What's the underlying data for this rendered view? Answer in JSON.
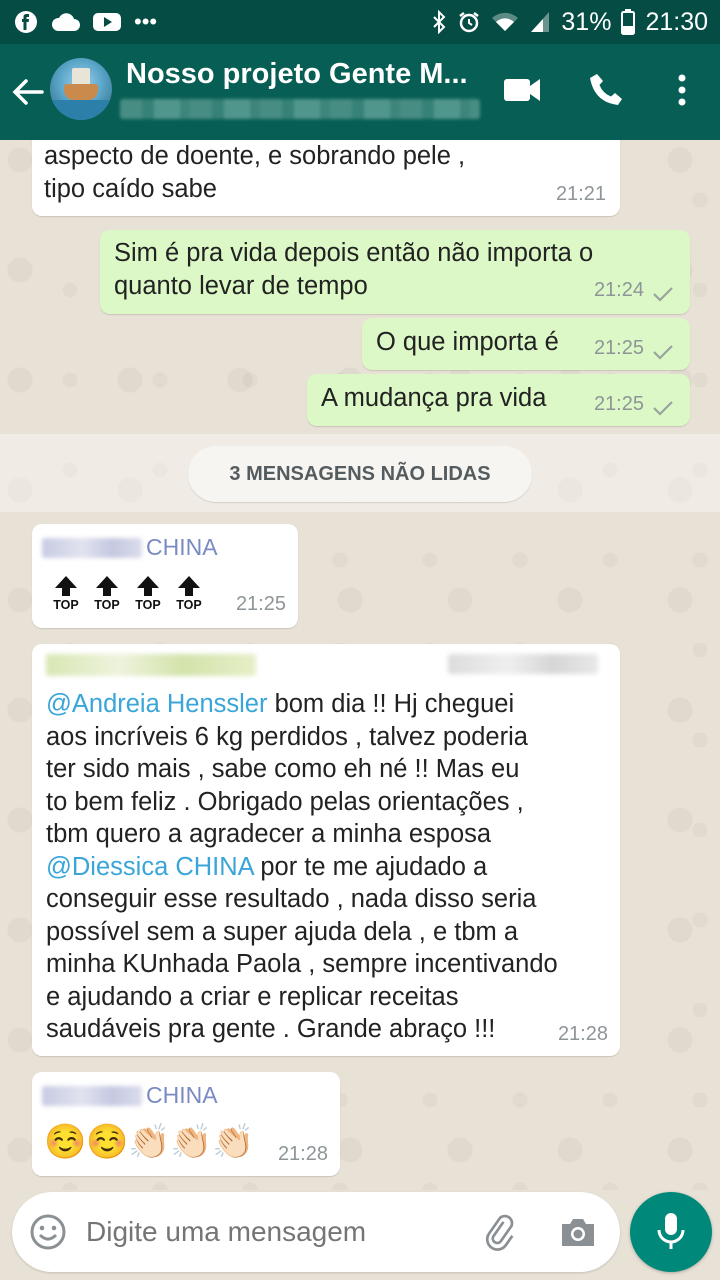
{
  "status_bar": {
    "battery": "31%",
    "time": "21:30",
    "icons": [
      "facebook-icon",
      "cloud-icon",
      "youtube-icon",
      "more-notifications-icon",
      "bluetooth-icon",
      "alarm-icon",
      "wifi-icon",
      "signal-icon",
      "battery-icon"
    ]
  },
  "header": {
    "title": "Nosso projeto Gente M...",
    "icons": [
      "back-arrow-icon",
      "video-call-icon",
      "phone-icon",
      "overflow-menu-icon"
    ]
  },
  "messages": [
    {
      "direction": "in",
      "text_lines": [
        "aspecto de doente, e sobrando pele ,",
        "tipo caído sabe"
      ],
      "time": "21:21"
    },
    {
      "direction": "out",
      "text_lines": [
        "Sim é  pra vida depois  então  não importa  o",
        "quanto levar de tempo"
      ],
      "time": "21:24",
      "status": "sent"
    },
    {
      "direction": "out",
      "text": "O que importa é",
      "time": "21:25",
      "status": "sent"
    },
    {
      "direction": "out",
      "text": "A mudança  pra vida",
      "time": "21:25",
      "status": "sent"
    },
    {
      "direction": "in",
      "sender": "CHINA",
      "content": [
        "TOP",
        "TOP",
        "TOP",
        "TOP"
      ],
      "time": "21:25"
    },
    {
      "direction": "in",
      "time": "21:28",
      "lines": [
        {
          "mention": "@Andreia Henssler",
          "text": " bom dia !! Hj cheguei"
        },
        {
          "text": "aos incríveis 6 kg perdidos , talvez poderia"
        },
        {
          "text": "ter sido mais , sabe como eh né !! Mas eu"
        },
        {
          "text": "to bem feliz . Obrigado pelas orientações ,"
        },
        {
          "text": "tbm quero a agradecer a minha esposa"
        },
        {
          "mention": "@Diessica CHINA",
          "text": "  por te me ajudado a"
        },
        {
          "text": "conseguir esse resultado , nada disso seria"
        },
        {
          "text": "possível sem a super ajuda dela , e tbm a"
        },
        {
          "text": "minha KUnhada Paola , sempre incentivando"
        },
        {
          "text": "e ajudando a criar  e replicar receitas"
        },
        {
          "text": "saudáveis pra gente . Grande abraço !!!"
        }
      ]
    },
    {
      "direction": "in",
      "sender": "CHINA",
      "emojis": [
        "☺️",
        "☺️",
        "👏🏻",
        "👏🏻",
        "👏🏻"
      ],
      "time": "21:28"
    }
  ],
  "unread_divider": "3 MENSAGENS NÃO LIDAS",
  "composer": {
    "placeholder": "Digite uma mensagem",
    "icons": [
      "emoji-icon",
      "attach-icon",
      "camera-icon",
      "mic-icon"
    ]
  },
  "colors": {
    "header": "#075e54",
    "status_bar": "#054d44",
    "outgoing_bubble": "#dcf8c6",
    "incoming_bubble": "#ffffff",
    "mention": "#3aa5d8",
    "sender_name": "#7a8ac2",
    "mic_button": "#00897b",
    "chat_background": "#e8e1d6"
  }
}
